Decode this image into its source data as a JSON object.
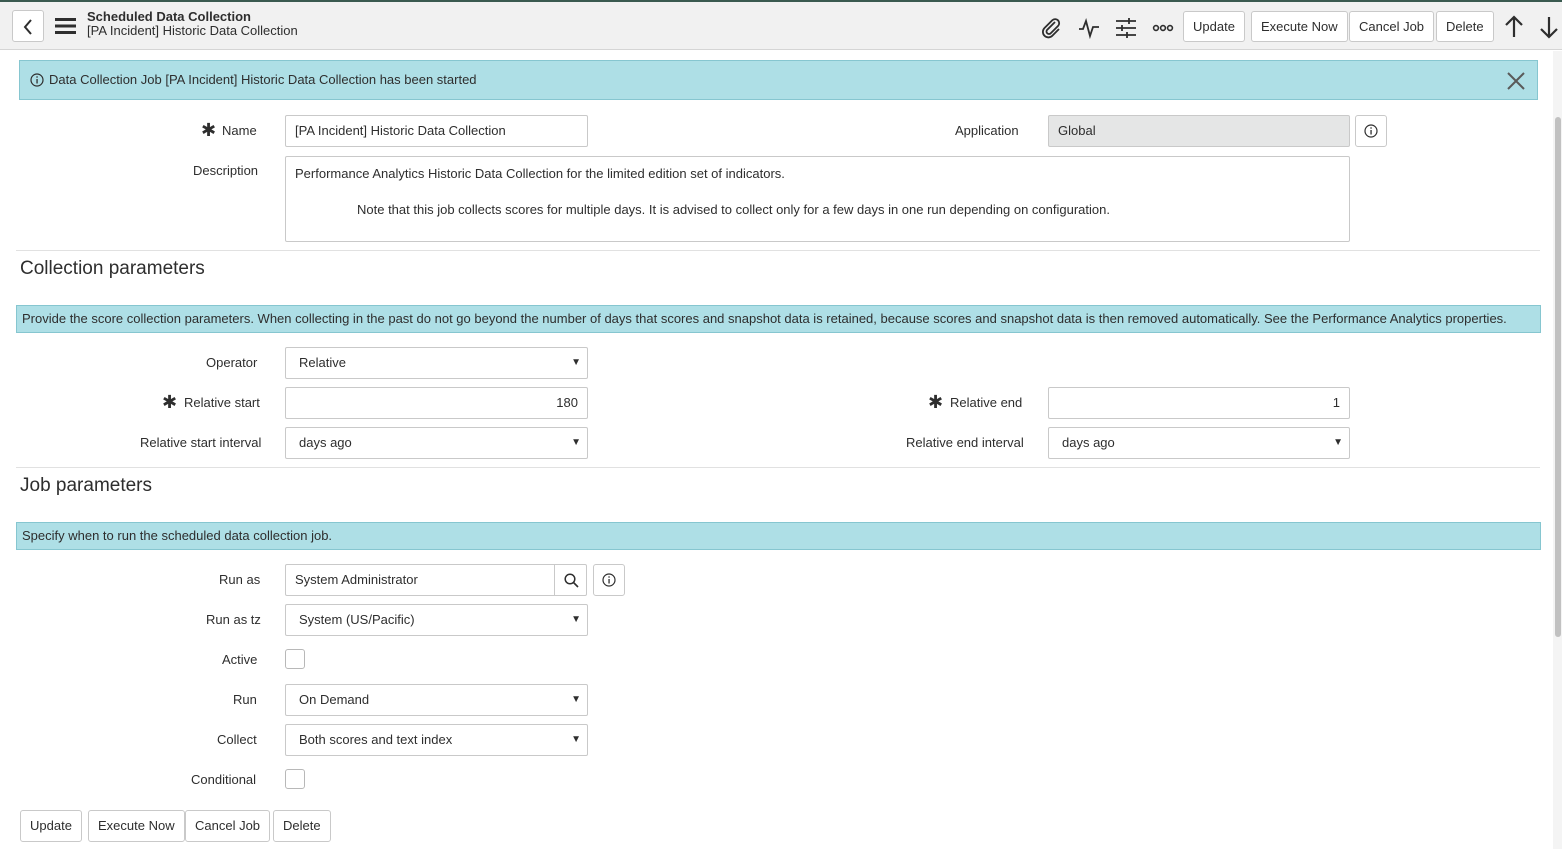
{
  "header": {
    "title": "Scheduled Data Collection",
    "subtitle": "[PA Incident] Historic Data Collection",
    "buttons": {
      "update": "Update",
      "execute_now": "Execute Now",
      "cancel_job": "Cancel Job",
      "delete": "Delete"
    },
    "icons": [
      "back-icon",
      "menu-icon",
      "paperclip-icon",
      "activity-icon",
      "sliders-icon",
      "more-icon",
      "arrow-up-icon",
      "arrow-down-icon"
    ]
  },
  "banner": {
    "message": "Data Collection Job [PA Incident] Historic Data Collection has been started"
  },
  "form": {
    "name": {
      "label": "Name",
      "value": "[PA Incident] Historic Data Collection"
    },
    "application": {
      "label": "Application",
      "value": "Global"
    },
    "description": {
      "label": "Description",
      "line1": "Performance Analytics Historic Data Collection for the limited edition set of indicators.",
      "line2": "Note that this job collects scores for multiple days. It is advised to collect only for a few days in one run depending on configuration."
    }
  },
  "collection": {
    "title": "Collection parameters",
    "hint": "Provide the score collection parameters. When collecting in the past do not go beyond the number of days that scores and snapshot data is retained, because scores and snapshot data is then removed automatically. See the Performance Analytics properties.",
    "operator": {
      "label": "Operator",
      "value": "Relative"
    },
    "relative_start": {
      "label": "Relative start",
      "value": "180"
    },
    "relative_end": {
      "label": "Relative end",
      "value": "1"
    },
    "start_interval": {
      "label": "Relative start interval",
      "value": "days ago"
    },
    "end_interval": {
      "label": "Relative end interval",
      "value": "days ago"
    }
  },
  "job": {
    "title": "Job parameters",
    "hint": "Specify when to run the scheduled data collection job.",
    "run_as": {
      "label": "Run as",
      "value": "System Administrator"
    },
    "run_as_tz": {
      "label": "Run as tz",
      "value": "System (US/Pacific)"
    },
    "active": {
      "label": "Active",
      "checked": false
    },
    "run": {
      "label": "Run",
      "value": "On Demand"
    },
    "collect": {
      "label": "Collect",
      "value": "Both scores and text index"
    },
    "conditional": {
      "label": "Conditional",
      "checked": false
    }
  },
  "footer": {
    "update": "Update",
    "execute_now": "Execute Now",
    "cancel_job": "Cancel Job",
    "delete": "Delete"
  },
  "colors": {
    "banner_bg": "#aedfe6",
    "banner_border": "#86c6d0",
    "header_bg": "#f1f1f1",
    "readonly_bg": "#e5e6e6"
  }
}
